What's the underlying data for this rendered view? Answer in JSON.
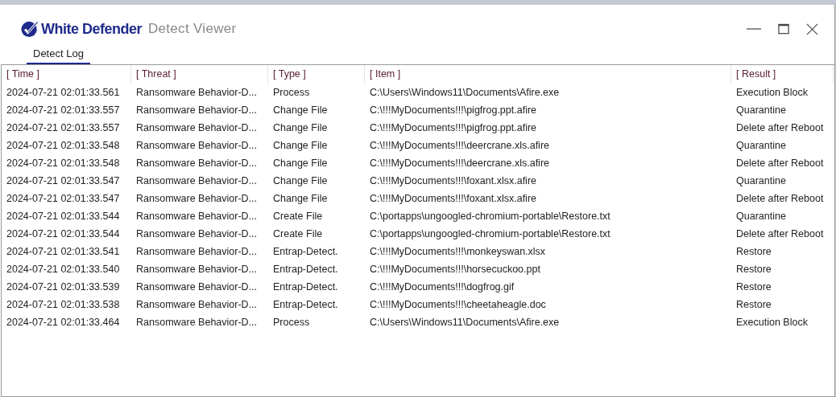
{
  "window": {
    "brand": "White Defender",
    "title": "Detect Viewer"
  },
  "tabs": [
    {
      "label": "Detect Log",
      "selected": true
    }
  ],
  "table": {
    "columns": [
      "[ Time ]",
      "[ Threat ]",
      "[ Type ]",
      "[ Item ]",
      "[ Result ]"
    ],
    "rows": [
      [
        "2024-07-21 02:01:33.561",
        "Ransomware Behavior-D...",
        "Process",
        "C:\\Users\\Windows11\\Documents\\Afire.exe",
        "Execution Block"
      ],
      [
        "2024-07-21 02:01:33.557",
        "Ransomware Behavior-D...",
        "Change File",
        "C:\\!!!MyDocuments!!!\\pigfrog.ppt.afire",
        "Quarantine"
      ],
      [
        "2024-07-21 02:01:33.557",
        "Ransomware Behavior-D...",
        "Change File",
        "C:\\!!!MyDocuments!!!\\pigfrog.ppt.afire",
        "Delete after Reboot"
      ],
      [
        "2024-07-21 02:01:33.548",
        "Ransomware Behavior-D...",
        "Change File",
        "C:\\!!!MyDocuments!!!\\deercrane.xls.afire",
        "Quarantine"
      ],
      [
        "2024-07-21 02:01:33.548",
        "Ransomware Behavior-D...",
        "Change File",
        "C:\\!!!MyDocuments!!!\\deercrane.xls.afire",
        "Delete after Reboot"
      ],
      [
        "2024-07-21 02:01:33.547",
        "Ransomware Behavior-D...",
        "Change File",
        "C:\\!!!MyDocuments!!!\\foxant.xlsx.afire",
        "Quarantine"
      ],
      [
        "2024-07-21 02:01:33.547",
        "Ransomware Behavior-D...",
        "Change File",
        "C:\\!!!MyDocuments!!!\\foxant.xlsx.afire",
        "Delete after Reboot"
      ],
      [
        "2024-07-21 02:01:33.544",
        "Ransomware Behavior-D...",
        "Create File",
        "C:\\portapps\\ungoogled-chromium-portable\\Restore.txt",
        "Quarantine"
      ],
      [
        "2024-07-21 02:01:33.544",
        "Ransomware Behavior-D...",
        "Create File",
        "C:\\portapps\\ungoogled-chromium-portable\\Restore.txt",
        "Delete after Reboot"
      ],
      [
        "2024-07-21 02:01:33.541",
        "Ransomware Behavior-D...",
        "Entrap-Detect.",
        "C:\\!!!MyDocuments!!!\\monkeyswan.xlsx",
        "Restore"
      ],
      [
        "2024-07-21 02:01:33.540",
        "Ransomware Behavior-D...",
        "Entrap-Detect.",
        "C:\\!!!MyDocuments!!!\\horsecuckoo.ppt",
        "Restore"
      ],
      [
        "2024-07-21 02:01:33.539",
        "Ransomware Behavior-D...",
        "Entrap-Detect.",
        "C:\\!!!MyDocuments!!!\\dogfrog.gif",
        "Restore"
      ],
      [
        "2024-07-21 02:01:33.538",
        "Ransomware Behavior-D...",
        "Entrap-Detect.",
        "C:\\!!!MyDocuments!!!\\cheetaheagle.doc",
        "Restore"
      ],
      [
        "2024-07-21 02:01:33.464",
        "Ransomware Behavior-D...",
        "Process",
        "C:\\Users\\Windows11\\Documents\\Afire.exe",
        "Execution Block"
      ]
    ]
  }
}
